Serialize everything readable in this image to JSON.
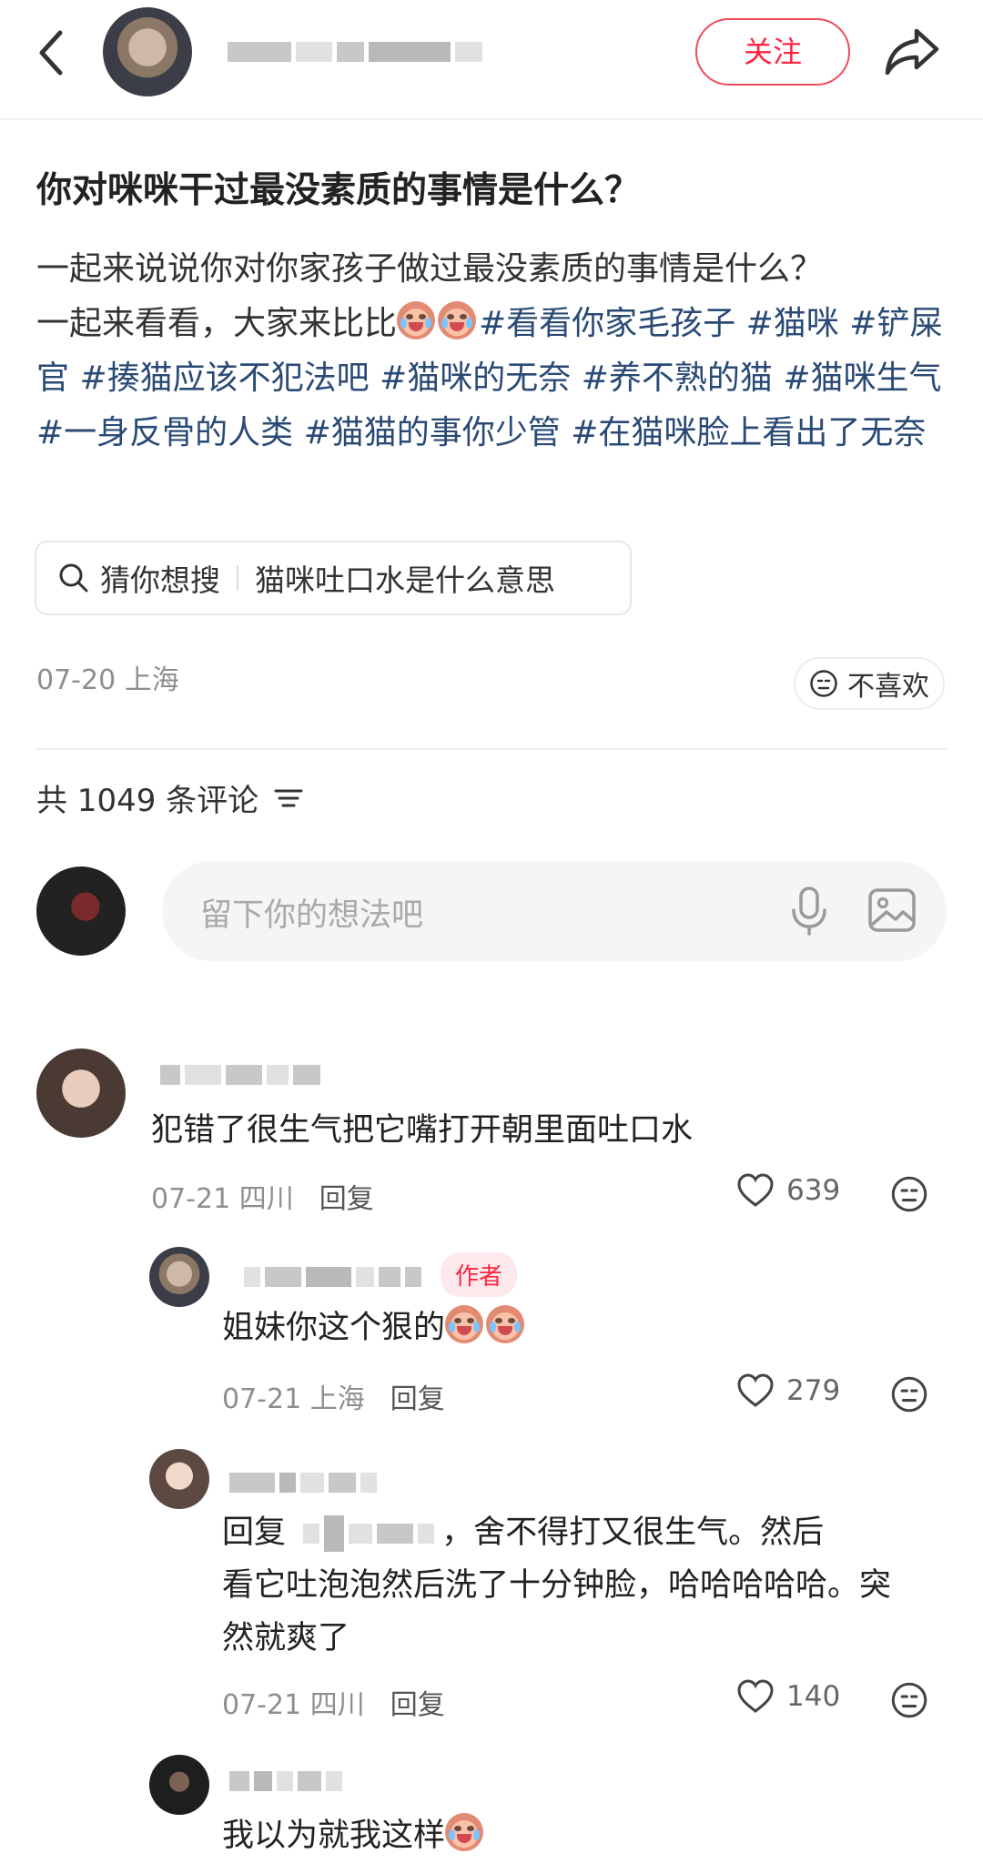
{
  "header": {
    "follow_label": "关注"
  },
  "post": {
    "title": "你对咪咪干过最没素质的事情是什么？",
    "desc_text_1": "一起来说说你对你家孩子做过最没素质的事情是什么？",
    "desc_text_2": "一起来看看，大家来比比",
    "tags": [
      "#看看你家毛孩子",
      "#猫咪",
      "#铲屎官",
      "#揍猫应该不犯法吧",
      "#猫咪的无奈",
      "#养不熟的猫",
      "#猫咪生气",
      "#一身反骨的人类",
      "#猫猫的事你少管",
      "#在猫咪脸上看出了无奈"
    ],
    "search_prefix": "猜你想搜",
    "search_query": "猫咪吐口水是什么意思",
    "date_location": "07-20 上海",
    "dislike_label": "不喜欢"
  },
  "comments_header": {
    "count_label": "共 1049 条评论"
  },
  "comment_input": {
    "placeholder": "留下你的想法吧"
  },
  "comments": [
    {
      "text": "犯错了很生气把它嘴打开朝里面吐口水",
      "date": "07-21 四川",
      "reply": "回复",
      "likes": "639"
    },
    {
      "badge": "作者",
      "text": "姐妹你这个狠的",
      "date": "07-21 上海",
      "reply": "回复",
      "likes": "279"
    },
    {
      "prefix": "回复",
      "text_after": "，舍不得打又很生气。然后",
      "text_2": "看它吐泡泡然后洗了十分钟脸，哈哈哈哈哈。突",
      "text_3": "然就爽了",
      "date": "07-21 四川",
      "reply": "回复",
      "likes": "140"
    },
    {
      "text": "我以为就我这样"
    }
  ]
}
